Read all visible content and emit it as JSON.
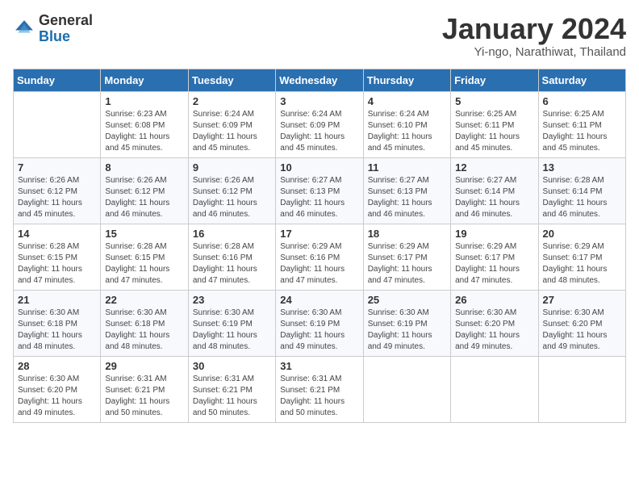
{
  "logo": {
    "line1": "General",
    "line2": "Blue"
  },
  "calendar": {
    "title": "January 2024",
    "subtitle": "Yi-ngo, Narathiwat, Thailand"
  },
  "headers": [
    "Sunday",
    "Monday",
    "Tuesday",
    "Wednesday",
    "Thursday",
    "Friday",
    "Saturday"
  ],
  "weeks": [
    [
      {
        "day": "",
        "sunrise": "",
        "sunset": "",
        "daylight": ""
      },
      {
        "day": "1",
        "sunrise": "Sunrise: 6:23 AM",
        "sunset": "Sunset: 6:08 PM",
        "daylight": "Daylight: 11 hours and 45 minutes."
      },
      {
        "day": "2",
        "sunrise": "Sunrise: 6:24 AM",
        "sunset": "Sunset: 6:09 PM",
        "daylight": "Daylight: 11 hours and 45 minutes."
      },
      {
        "day": "3",
        "sunrise": "Sunrise: 6:24 AM",
        "sunset": "Sunset: 6:09 PM",
        "daylight": "Daylight: 11 hours and 45 minutes."
      },
      {
        "day": "4",
        "sunrise": "Sunrise: 6:24 AM",
        "sunset": "Sunset: 6:10 PM",
        "daylight": "Daylight: 11 hours and 45 minutes."
      },
      {
        "day": "5",
        "sunrise": "Sunrise: 6:25 AM",
        "sunset": "Sunset: 6:11 PM",
        "daylight": "Daylight: 11 hours and 45 minutes."
      },
      {
        "day": "6",
        "sunrise": "Sunrise: 6:25 AM",
        "sunset": "Sunset: 6:11 PM",
        "daylight": "Daylight: 11 hours and 45 minutes."
      }
    ],
    [
      {
        "day": "7",
        "sunrise": "Sunrise: 6:26 AM",
        "sunset": "Sunset: 6:12 PM",
        "daylight": "Daylight: 11 hours and 45 minutes."
      },
      {
        "day": "8",
        "sunrise": "Sunrise: 6:26 AM",
        "sunset": "Sunset: 6:12 PM",
        "daylight": "Daylight: 11 hours and 46 minutes."
      },
      {
        "day": "9",
        "sunrise": "Sunrise: 6:26 AM",
        "sunset": "Sunset: 6:12 PM",
        "daylight": "Daylight: 11 hours and 46 minutes."
      },
      {
        "day": "10",
        "sunrise": "Sunrise: 6:27 AM",
        "sunset": "Sunset: 6:13 PM",
        "daylight": "Daylight: 11 hours and 46 minutes."
      },
      {
        "day": "11",
        "sunrise": "Sunrise: 6:27 AM",
        "sunset": "Sunset: 6:13 PM",
        "daylight": "Daylight: 11 hours and 46 minutes."
      },
      {
        "day": "12",
        "sunrise": "Sunrise: 6:27 AM",
        "sunset": "Sunset: 6:14 PM",
        "daylight": "Daylight: 11 hours and 46 minutes."
      },
      {
        "day": "13",
        "sunrise": "Sunrise: 6:28 AM",
        "sunset": "Sunset: 6:14 PM",
        "daylight": "Daylight: 11 hours and 46 minutes."
      }
    ],
    [
      {
        "day": "14",
        "sunrise": "Sunrise: 6:28 AM",
        "sunset": "Sunset: 6:15 PM",
        "daylight": "Daylight: 11 hours and 47 minutes."
      },
      {
        "day": "15",
        "sunrise": "Sunrise: 6:28 AM",
        "sunset": "Sunset: 6:15 PM",
        "daylight": "Daylight: 11 hours and 47 minutes."
      },
      {
        "day": "16",
        "sunrise": "Sunrise: 6:28 AM",
        "sunset": "Sunset: 6:16 PM",
        "daylight": "Daylight: 11 hours and 47 minutes."
      },
      {
        "day": "17",
        "sunrise": "Sunrise: 6:29 AM",
        "sunset": "Sunset: 6:16 PM",
        "daylight": "Daylight: 11 hours and 47 minutes."
      },
      {
        "day": "18",
        "sunrise": "Sunrise: 6:29 AM",
        "sunset": "Sunset: 6:17 PM",
        "daylight": "Daylight: 11 hours and 47 minutes."
      },
      {
        "day": "19",
        "sunrise": "Sunrise: 6:29 AM",
        "sunset": "Sunset: 6:17 PM",
        "daylight": "Daylight: 11 hours and 47 minutes."
      },
      {
        "day": "20",
        "sunrise": "Sunrise: 6:29 AM",
        "sunset": "Sunset: 6:17 PM",
        "daylight": "Daylight: 11 hours and 48 minutes."
      }
    ],
    [
      {
        "day": "21",
        "sunrise": "Sunrise: 6:30 AM",
        "sunset": "Sunset: 6:18 PM",
        "daylight": "Daylight: 11 hours and 48 minutes."
      },
      {
        "day": "22",
        "sunrise": "Sunrise: 6:30 AM",
        "sunset": "Sunset: 6:18 PM",
        "daylight": "Daylight: 11 hours and 48 minutes."
      },
      {
        "day": "23",
        "sunrise": "Sunrise: 6:30 AM",
        "sunset": "Sunset: 6:19 PM",
        "daylight": "Daylight: 11 hours and 48 minutes."
      },
      {
        "day": "24",
        "sunrise": "Sunrise: 6:30 AM",
        "sunset": "Sunset: 6:19 PM",
        "daylight": "Daylight: 11 hours and 49 minutes."
      },
      {
        "day": "25",
        "sunrise": "Sunrise: 6:30 AM",
        "sunset": "Sunset: 6:19 PM",
        "daylight": "Daylight: 11 hours and 49 minutes."
      },
      {
        "day": "26",
        "sunrise": "Sunrise: 6:30 AM",
        "sunset": "Sunset: 6:20 PM",
        "daylight": "Daylight: 11 hours and 49 minutes."
      },
      {
        "day": "27",
        "sunrise": "Sunrise: 6:30 AM",
        "sunset": "Sunset: 6:20 PM",
        "daylight": "Daylight: 11 hours and 49 minutes."
      }
    ],
    [
      {
        "day": "28",
        "sunrise": "Sunrise: 6:30 AM",
        "sunset": "Sunset: 6:20 PM",
        "daylight": "Daylight: 11 hours and 49 minutes."
      },
      {
        "day": "29",
        "sunrise": "Sunrise: 6:31 AM",
        "sunset": "Sunset: 6:21 PM",
        "daylight": "Daylight: 11 hours and 50 minutes."
      },
      {
        "day": "30",
        "sunrise": "Sunrise: 6:31 AM",
        "sunset": "Sunset: 6:21 PM",
        "daylight": "Daylight: 11 hours and 50 minutes."
      },
      {
        "day": "31",
        "sunrise": "Sunrise: 6:31 AM",
        "sunset": "Sunset: 6:21 PM",
        "daylight": "Daylight: 11 hours and 50 minutes."
      },
      {
        "day": "",
        "sunrise": "",
        "sunset": "",
        "daylight": ""
      },
      {
        "day": "",
        "sunrise": "",
        "sunset": "",
        "daylight": ""
      },
      {
        "day": "",
        "sunrise": "",
        "sunset": "",
        "daylight": ""
      }
    ]
  ]
}
